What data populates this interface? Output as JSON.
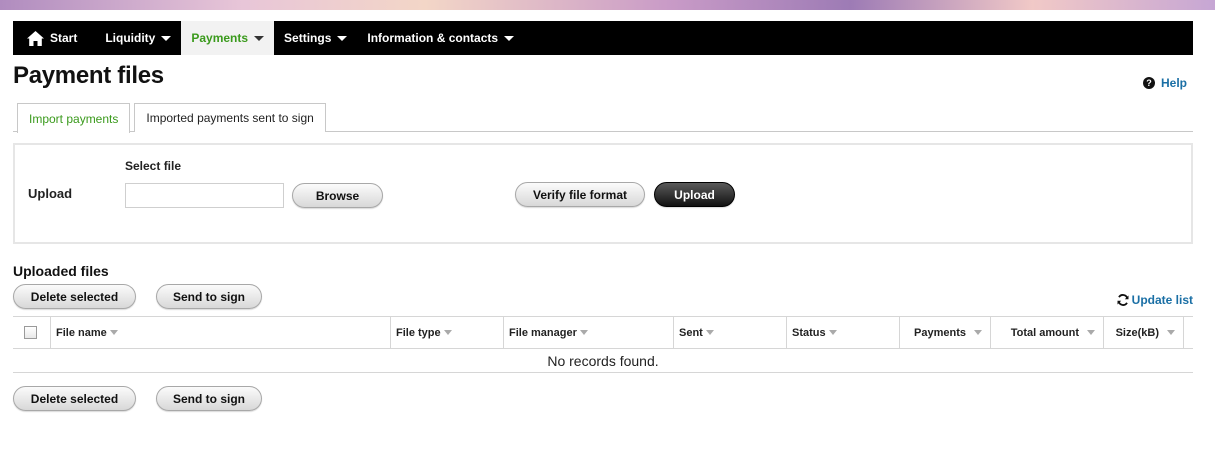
{
  "nav": {
    "items": [
      {
        "label": "Start"
      },
      {
        "label": "Liquidity"
      },
      {
        "label": "Payments"
      },
      {
        "label": "Settings"
      },
      {
        "label": "Information & contacts"
      }
    ]
  },
  "page": {
    "title": "Payment files",
    "help_label": "Help"
  },
  "tabs": [
    {
      "label": "Import payments",
      "active": true
    },
    {
      "label": "Imported payments sent to sign",
      "active": false
    }
  ],
  "upload": {
    "section_label": "Upload",
    "select_file_label": "Select file",
    "file_value": "",
    "browse_label": "Browse",
    "verify_label": "Verify file format",
    "upload_label": "Upload"
  },
  "uploaded": {
    "title": "Uploaded files",
    "delete_label": "Delete selected",
    "send_label": "Send to sign",
    "update_label": "Update list",
    "columns": [
      "File name",
      "File type",
      "File manager",
      "Sent",
      "Status",
      "Payments",
      "Total amount",
      "Size(kB)"
    ],
    "empty_text": "No records found."
  },
  "colors": {
    "accent_green": "#3a9a1c",
    "link_blue": "#1a6fa5",
    "nav_bg": "#000000"
  }
}
